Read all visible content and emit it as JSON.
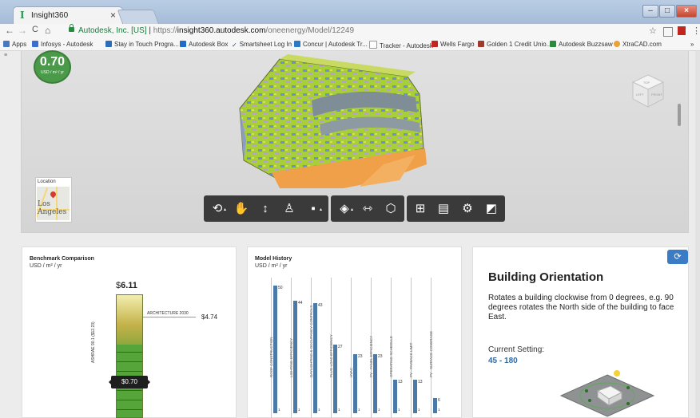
{
  "browser": {
    "tab_title": "Insight360",
    "tab_close": "×",
    "nav": {
      "back": "←",
      "forward": "→",
      "reload": "C",
      "home": "⌂"
    },
    "address": {
      "org": "Autodesk, Inc. [US]",
      "sep": " | ",
      "scheme": "https://",
      "host": "insight360.autodesk.com",
      "path": "/oneenergy/Model/12249"
    },
    "bookmarks": [
      {
        "label": "Apps",
        "color": "#4a78c0"
      },
      {
        "label": "Infosys - Autodesk",
        "color": "#3a6fcf"
      },
      {
        "label": "Stay in Touch Progra...",
        "color": "#2c6cb8"
      },
      {
        "label": "Autodesk Box",
        "color": "#1f6cc8"
      },
      {
        "label": "Smartsheet Log In",
        "color": "#2a4f6e"
      },
      {
        "label": "Concur | Autodesk Tr...",
        "color": "#2c79c5"
      },
      {
        "label": "Tracker - Autodesk",
        "color": "#999999"
      },
      {
        "label": "Wells Fargo",
        "color": "#c2261e"
      },
      {
        "label": "Golden 1 Credit Unio...",
        "color": "#a03a2e"
      },
      {
        "label": "Autodesk Buzzsaw",
        "color": "#2b8a3e"
      },
      {
        "label": "XtraCAD.com",
        "color": "#e9a23b"
      }
    ],
    "more": "»"
  },
  "viewer": {
    "score_value": "0.70",
    "score_unit": "USD / m² / yr",
    "location_label": "Location",
    "location_city": "Los Angeles",
    "toolbar_groups": [
      [
        "⟲",
        "✋",
        "↕",
        "🚶",
        "■"
      ],
      [
        "◈",
        "⇿",
        "⬡"
      ],
      [
        "⊞",
        "▤",
        "⚙",
        "◩"
      ]
    ],
    "viewcube": {
      "top": "TOP",
      "left": "LEFT",
      "front": "FRONT"
    }
  },
  "benchmark": {
    "title": "Benchmark Comparison",
    "unit": "USD / m² / yr",
    "top_value": "6.11",
    "currency": "$",
    "ashrae_label": "ASHRAE 90.1 ($12.23)",
    "architecture_label": "ARCHITECTURE 2030",
    "architecture_value": "$4.74",
    "current_value": "$0.70"
  },
  "history": {
    "title": "Model History",
    "unit": "USD / m² / yr",
    "bars": [
      {
        "label": "ROOF CONSTRUCTION",
        "value": 50,
        "base": 1
      },
      {
        "label": "LIGHTING EFFICIENCY",
        "value": 44,
        "base": 1
      },
      {
        "label": "DAYLIGHTING & OCCUPANCY CONTROLS",
        "value": 43,
        "base": 1
      },
      {
        "label": "PLUG LOAD EFFICIENCY",
        "value": 27,
        "base": 1
      },
      {
        "label": "HVAC",
        "value": 23,
        "base": 1
      },
      {
        "label": "PV - PANEL EFFICIENCY",
        "value": 23,
        "base": 1
      },
      {
        "label": "OPERATING SCHEDULE",
        "value": 13,
        "base": 1
      },
      {
        "label": "PV - PAYBACK LIMIT",
        "value": 13,
        "base": 1
      },
      {
        "label": "PV - SURFACE COVERAGE",
        "value": 6,
        "base": 1
      }
    ]
  },
  "orientation": {
    "title": "Building Orientation",
    "description": "Rotates a building clockwise from 0 degrees, e.g. 90 degrees rotates the North side of the building to face East.",
    "current_label": "Current Setting:",
    "current_range": "45 - 180",
    "rotate_icon": "⟳"
  },
  "colors": {
    "accent": "#3b7cc4",
    "score_green": "#4b9a4a",
    "bar_blue": "#4b79a8",
    "toolbar_dark": "#3a3a3a"
  }
}
